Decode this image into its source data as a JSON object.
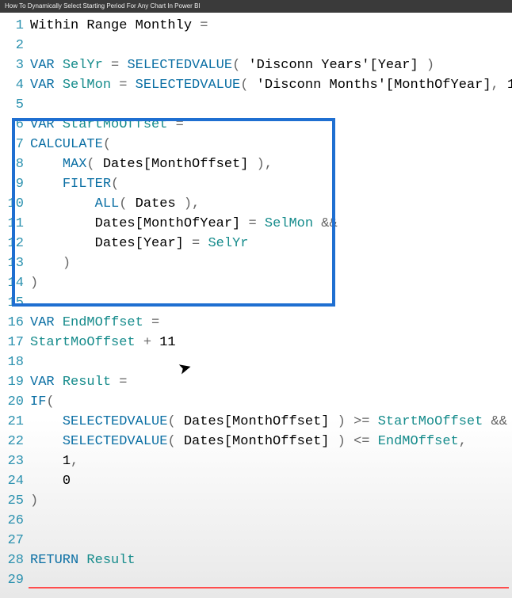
{
  "titleBar": "How To Dynamically Select Starting Period For Any Chart In Power BI",
  "code": {
    "measureName": "Within Range Monthly",
    "kwVar": "VAR",
    "kwReturn": "RETURN",
    "fnSelectedValue": "SELECTEDVALUE",
    "fnCalculate": "CALCULATE",
    "fnMax": "MAX",
    "fnFilter": "FILTER",
    "fnAll": "ALL",
    "fnIf": "IF",
    "vSelYr": "SelYr",
    "vSelMon": "SelMon",
    "vStartMoOffset": "StartMoOffset",
    "vEndMOffset": "EndMOffset",
    "vResult": "Result",
    "tblDisconnYearsYear": "'Disconn Years'[Year]",
    "tblDisconnMonthsMOY": "'Disconn Months'[MonthOfYear]",
    "tblDatesMonthOffset": "Dates[MonthOffset]",
    "tblDates": "Dates",
    "tblDatesMOY": "Dates[MonthOfYear]",
    "tblDatesYear": "Dates[Year]",
    "numOne": "1",
    "numEleven": "11",
    "numZero": "0",
    "opAnd": "&&",
    "opGte": ">=",
    "opLte": "<="
  },
  "lineNumbers": [
    "1",
    "2",
    "3",
    "4",
    "5",
    "6",
    "7",
    "8",
    "9",
    "10",
    "11",
    "12",
    "13",
    "14",
    "15",
    "16",
    "17",
    "18",
    "19",
    "20",
    "21",
    "22",
    "23",
    "24",
    "25",
    "26",
    "27",
    "28",
    "29"
  ]
}
